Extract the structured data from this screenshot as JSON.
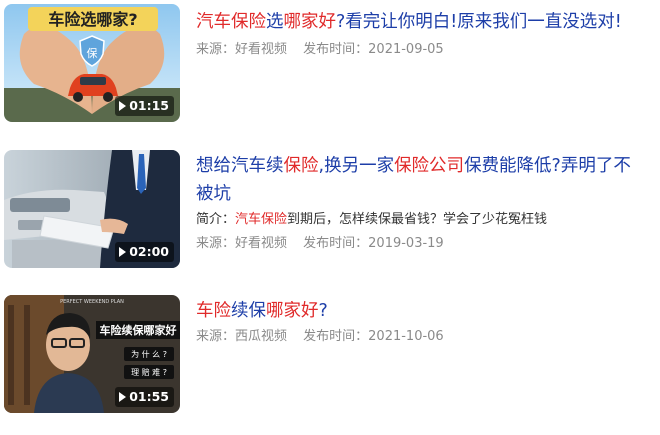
{
  "results": [
    {
      "title_parts": [
        {
          "text": "汽车保险",
          "hl": true
        },
        {
          "text": "选",
          "hl": false
        },
        {
          "text": "哪家好",
          "hl": true
        },
        {
          "text": "?看完让你明白!原来我们一直没选对!",
          "hl": false
        }
      ],
      "duration": "01:15",
      "thumb_caption": "车险选哪家?",
      "thumb_badge": "保",
      "source": "来源：好看视频",
      "date": "发布时间：2021-09-05"
    },
    {
      "title_parts": [
        {
          "text": "想给汽车续",
          "hl": false
        },
        {
          "text": "保险",
          "hl": true
        },
        {
          "text": ",换另一家",
          "hl": false
        },
        {
          "text": "保险公司",
          "hl": true
        },
        {
          "text": "保费能降低?弄明了不被坑",
          "hl": false
        }
      ],
      "snippet_parts": [
        {
          "text": "简介：",
          "hl": false
        },
        {
          "text": "汽车保险",
          "hl": true
        },
        {
          "text": "到期后，怎样续保最省钱？学会了少花冤枉钱",
          "hl": false
        }
      ],
      "duration": "02:00",
      "source": "来源：好看视频",
      "date": "发布时间：2019-03-19"
    },
    {
      "title_parts": [
        {
          "text": "车险",
          "hl": true
        },
        {
          "text": "续保",
          "hl": false
        },
        {
          "text": "哪家好",
          "hl": true
        },
        {
          "text": "?",
          "hl": false
        }
      ],
      "duration": "01:55",
      "thumb_caption": "车险续保哪家好",
      "thumb_small": "PERFECT WEEKEND PLAN",
      "thumb_q1": "为 什 么 ?",
      "thumb_q2": "理 赔 难 ?",
      "source": "来源：西瓜视频",
      "date": "发布时间：2021-10-06"
    }
  ]
}
